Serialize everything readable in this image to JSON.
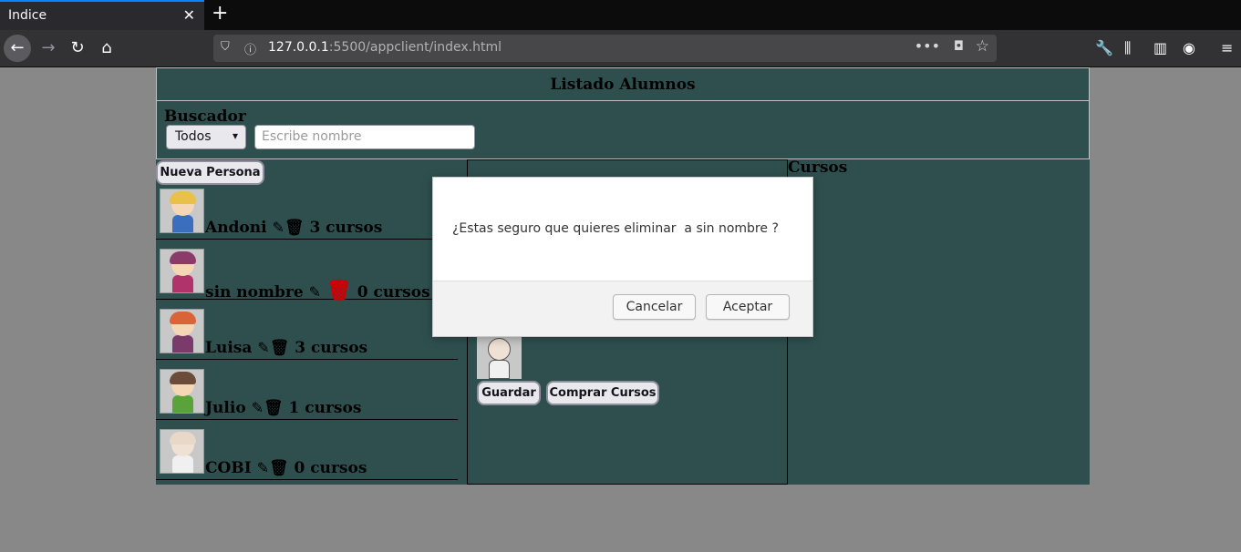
{
  "browser": {
    "tab_title": "Indice",
    "tab_close": "✕",
    "new_tab": "+",
    "url_host": "127.0.0.1",
    "url_rest": ":5500/appclient/index.html"
  },
  "page": {
    "title": "Listado Alumnos",
    "search": {
      "title": "Buscador",
      "select_value": "Todos",
      "input_placeholder": "Escribe nombre"
    },
    "new_person_label": "Nueva Persona",
    "persons": [
      {
        "name": "Andoni",
        "courses": "3 cursos",
        "hair": "#e8c04a",
        "skin": "#f5d7b5",
        "body": "#3a6fbf"
      },
      {
        "name": "sin nombre",
        "courses": "0 cursos",
        "hair": "#8a3b6a",
        "skin": "#f5d7b5",
        "body": "#b0336b"
      },
      {
        "name": "Luisa",
        "courses": "3 cursos",
        "hair": "#d9643a",
        "skin": "#f5d7b5",
        "body": "#7a3b6a"
      },
      {
        "name": "Julio",
        "courses": "1 cursos",
        "hair": "#6b4b3a",
        "skin": "#f5d7b5",
        "body": "#5aa33a"
      },
      {
        "name": "COBI",
        "courses": "0 cursos",
        "hair": "#e8d8c8",
        "skin": "#efe2d4",
        "body": "#f0f0f0"
      }
    ],
    "save_label": "Guardar",
    "buy_label": "Comprar Cursos",
    "courses_title": "Cursos"
  },
  "modal": {
    "message": "¿Estas seguro que quieres eliminar  a sin nombre ?",
    "cancel_label": "Cancelar",
    "accept_label": "Aceptar"
  },
  "colors": {
    "page_bg": "#2f4f4f",
    "trash_active": "#cc0000"
  }
}
